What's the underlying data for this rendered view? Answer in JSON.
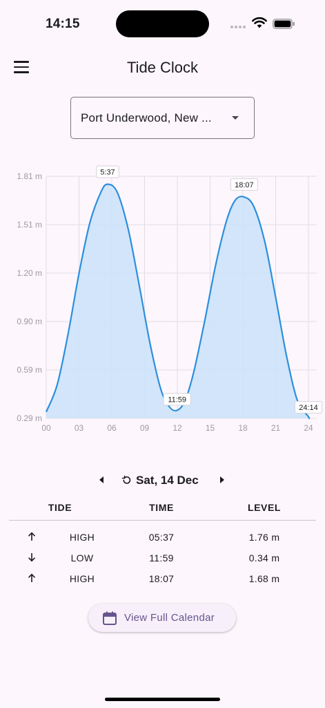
{
  "status_bar": {
    "time": "14:15"
  },
  "app_bar": {
    "title": "Tide Clock"
  },
  "location": {
    "selected": "Port Underwood, New ..."
  },
  "chart_data": {
    "type": "area",
    "x_ticks": [
      "00",
      "03",
      "06",
      "09",
      "12",
      "15",
      "18",
      "21",
      "24"
    ],
    "y_ticks": [
      "0.29 m",
      "0.59 m",
      "0.90 m",
      "1.20 m",
      "1.51 m",
      "1.81 m"
    ],
    "xlim": [
      0,
      24
    ],
    "ylim": [
      0.29,
      1.81
    ],
    "grid": true,
    "series": [
      {
        "x": [
          0,
          1,
          2,
          3,
          4,
          5,
          5.62,
          6.5,
          7.5,
          8.5,
          9.5,
          10.5,
          11.3,
          11.98,
          12.7,
          13.5,
          14.5,
          15.5,
          16.5,
          17.3,
          18.12,
          19,
          20,
          21,
          22,
          23,
          24,
          24.23
        ],
        "y": [
          0.33,
          0.5,
          0.82,
          1.2,
          1.52,
          1.71,
          1.76,
          1.71,
          1.48,
          1.13,
          0.76,
          0.47,
          0.36,
          0.34,
          0.4,
          0.58,
          0.9,
          1.25,
          1.53,
          1.66,
          1.68,
          1.62,
          1.4,
          1.05,
          0.68,
          0.4,
          0.3,
          0.29
        ]
      }
    ],
    "annotations": [
      {
        "x": 5.62,
        "y": 1.76,
        "label": "5:37"
      },
      {
        "x": 11.98,
        "y": 0.34,
        "label": "11:59"
      },
      {
        "x": 18.12,
        "y": 1.68,
        "label": "18:07"
      },
      {
        "x": 24.23,
        "y": 0.29,
        "label": "24:14"
      }
    ],
    "colors": {
      "line": "#2b8fdc",
      "fill": "#cde3fa",
      "grid": "#e0dde3",
      "tick": "#9e9aa2"
    }
  },
  "date_nav": {
    "date": "Sat, 14 Dec"
  },
  "table": {
    "headers": {
      "tide": "TIDE",
      "time": "TIME",
      "level": "LEVEL"
    },
    "rows": [
      {
        "direction": "up",
        "type": "HIGH",
        "time": "05:37",
        "level": "1.76 m"
      },
      {
        "direction": "down",
        "type": "LOW",
        "time": "11:59",
        "level": "0.34 m"
      },
      {
        "direction": "up",
        "type": "HIGH",
        "time": "18:07",
        "level": "1.68 m"
      }
    ]
  },
  "calendar_button": {
    "label": "View Full Calendar"
  },
  "colors": {
    "background": "#fdf6fc",
    "accent": "#65558f"
  }
}
